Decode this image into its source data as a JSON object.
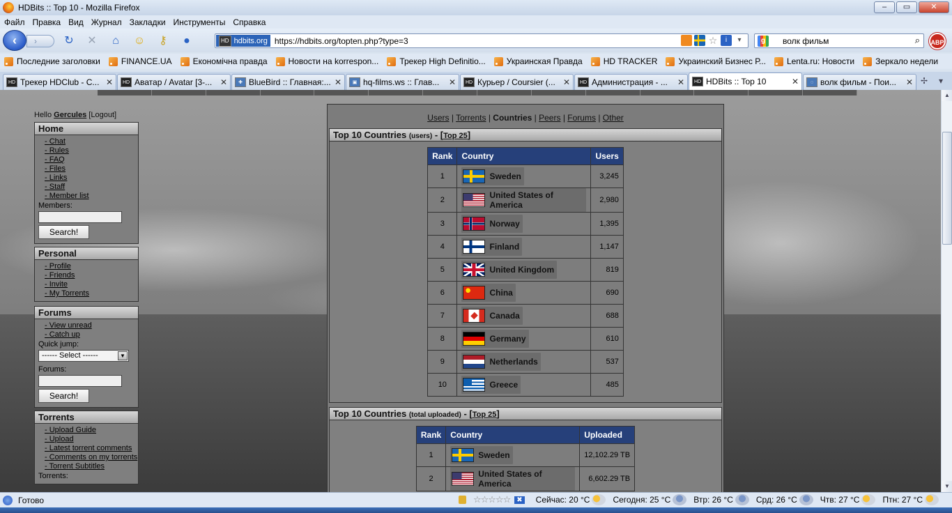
{
  "window": {
    "title": "HDBits :: Top 10 - Mozilla Firefox",
    "buttons": {
      "minimize": "–",
      "maximize": "▭",
      "close": "✕"
    }
  },
  "menu": [
    "Файл",
    "Правка",
    "Вид",
    "Журнал",
    "Закладки",
    "Инструменты",
    "Справка"
  ],
  "nav": {
    "site_identity": "hdbits.org",
    "url": "https://hdbits.org/topten.php?type=3",
    "search_text": "волк фильм"
  },
  "bookmarks": [
    "Последние заголовки",
    "FINANCE.UA",
    "Економічна правда",
    "Новости на korrespon...",
    "Трекер High Definitio...",
    "Украинская Правда",
    "HD TRACKER",
    "Украинский Бизнес Р...",
    "Lenta.ru: Новости",
    "Зеркало недели"
  ],
  "tabs": [
    {
      "label": "Трекер HDClub - С...",
      "active": false
    },
    {
      "label": "Аватар / Avatar [3-...",
      "active": false
    },
    {
      "label": "BlueBird :: Главная:...",
      "active": false
    },
    {
      "label": "hq-films.ws :: Глав...",
      "active": false
    },
    {
      "label": "Курьер / Coursier (...",
      "active": false
    },
    {
      "label": "Администрация - ...",
      "active": false
    },
    {
      "label": "HDBits :: Top 10",
      "active": true
    },
    {
      "label": "волк фильм - Пои...",
      "active": false
    }
  ],
  "page": {
    "hello": "Hello",
    "username": "Gercules",
    "logout": "[Logout]",
    "home": {
      "title": "Home",
      "links": [
        "Chat",
        "Rules",
        "FAQ",
        "Files",
        "Links",
        "Staff",
        "Member list"
      ],
      "members_label": "Members:",
      "search_button": "Search!"
    },
    "personal": {
      "title": "Personal",
      "links": [
        "Profile",
        "Friends",
        "Invite",
        "My Torrents"
      ]
    },
    "forums": {
      "title": "Forums",
      "links": [
        "View unread",
        "Catch up"
      ],
      "quick_jump_label": "Quick jump:",
      "select_value": "------ Select ------",
      "forums_label": "Forums:",
      "search_button": "Search!"
    },
    "torrents": {
      "title": "Torrents",
      "links": [
        "Upload Guide",
        "Upload",
        "Latest torrent comments",
        "Comments on my torrents",
        "Torrent Subtitles"
      ],
      "torrents_label": "Torrents:"
    },
    "sublinks": {
      "users": "Users",
      "torrents": "Torrents",
      "countries": "Countries",
      "peers": "Peers",
      "forums": "Forums",
      "other": "Other",
      "sep": "|"
    },
    "panel1": {
      "title": "Top 10 Countries",
      "subtitle": "(users)",
      "dash": "-",
      "top25": "Top 25",
      "headers": [
        "Rank",
        "Country",
        "Users"
      ],
      "rows": [
        {
          "rank": "1",
          "country": "Sweden",
          "flag": "se",
          "value": "3,245"
        },
        {
          "rank": "2",
          "country": "United States of America",
          "flag": "us",
          "value": "2,980"
        },
        {
          "rank": "3",
          "country": "Norway",
          "flag": "no",
          "value": "1,395"
        },
        {
          "rank": "4",
          "country": "Finland",
          "flag": "fi",
          "value": "1,147"
        },
        {
          "rank": "5",
          "country": "United Kingdom",
          "flag": "gb",
          "value": "819"
        },
        {
          "rank": "6",
          "country": "China",
          "flag": "cn",
          "value": "690"
        },
        {
          "rank": "7",
          "country": "Canada",
          "flag": "ca",
          "value": "688"
        },
        {
          "rank": "8",
          "country": "Germany",
          "flag": "de",
          "value": "610"
        },
        {
          "rank": "9",
          "country": "Netherlands",
          "flag": "nl",
          "value": "537"
        },
        {
          "rank": "10",
          "country": "Greece",
          "flag": "gr",
          "value": "485"
        }
      ]
    },
    "panel2": {
      "title": "Top 10 Countries",
      "subtitle": "(total uploaded)",
      "dash": "-",
      "top25": "Top 25",
      "headers": [
        "Rank",
        "Country",
        "Uploaded"
      ],
      "rows": [
        {
          "rank": "1",
          "country": "Sweden",
          "flag": "se",
          "value": "12,102.29 TB"
        },
        {
          "rank": "2",
          "country": "United States of America",
          "flag": "us",
          "value": "6,602.29 TB"
        }
      ]
    }
  },
  "status": {
    "text": "Готово",
    "weather": [
      {
        "label": "Сейчас: 20 °C",
        "icon": "sun"
      },
      {
        "label": "Сегодня: 25 °C",
        "icon": "rain"
      },
      {
        "label": "Втр: 26 °C",
        "icon": "rain"
      },
      {
        "label": "Срд: 26 °C",
        "icon": "rain"
      },
      {
        "label": "Чтв: 27 °C",
        "icon": "sun"
      },
      {
        "label": "Птн: 27 °C",
        "icon": "sun"
      }
    ]
  }
}
